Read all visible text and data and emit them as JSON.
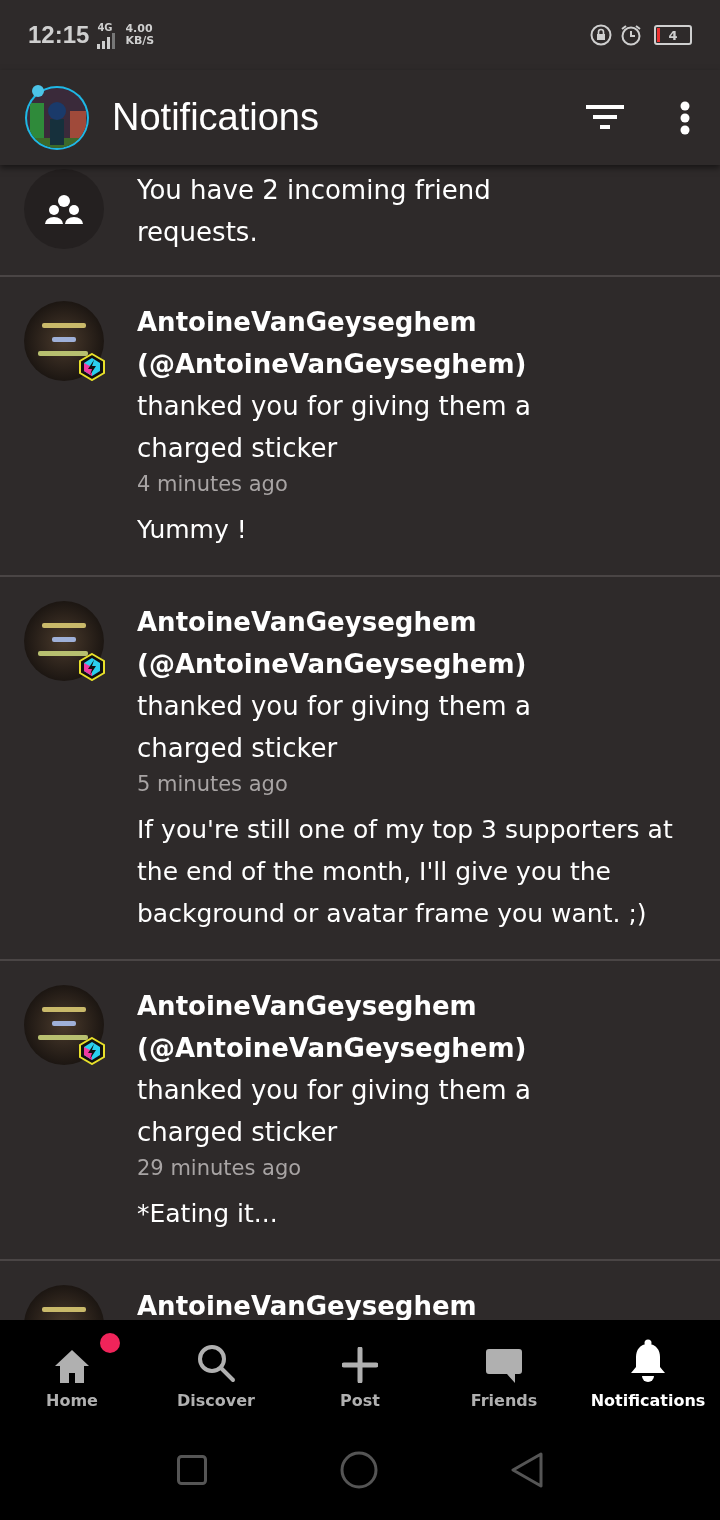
{
  "status_bar": {
    "time": "12:15",
    "network": "4G",
    "speed": "4.00",
    "speed_unit": "KB/S",
    "battery": "4"
  },
  "header": {
    "title": "Notifications"
  },
  "friend_requests": {
    "text": "You have 2 incoming friend requests."
  },
  "notifications": [
    {
      "name": "AntoineVanGeyseghem",
      "handle": "(@AntoineVanGeyseghem)",
      "action": "thanked you for giving them a charged sticker",
      "time": "4 minutes ago",
      "message": "Yummy !"
    },
    {
      "name": "AntoineVanGeyseghem",
      "handle": "(@AntoineVanGeyseghem)",
      "action": "thanked you for giving them a charged sticker",
      "time": "5 minutes ago",
      "message": "If you're still one of my top 3 supporters at the end of the month, I'll give you the background or avatar frame you want. ;)"
    },
    {
      "name": "AntoineVanGeyseghem",
      "handle": "(@AntoineVanGeyseghem)",
      "action": "thanked you for giving them a charged sticker",
      "time": "29 minutes ago",
      "message": "*Eating it..."
    },
    {
      "name": "AntoineVanGeyseghem"
    }
  ],
  "nav": [
    {
      "kind": "home",
      "label": "Home",
      "selected": false,
      "badge": true
    },
    {
      "kind": "search",
      "label": "Discover",
      "selected": false,
      "badge": false
    },
    {
      "kind": "plus",
      "label": "Post",
      "selected": false,
      "badge": false
    },
    {
      "kind": "chat",
      "label": "Friends",
      "selected": false,
      "badge": false
    },
    {
      "kind": "bell",
      "label": "Notifications",
      "selected": true,
      "badge": false
    }
  ]
}
